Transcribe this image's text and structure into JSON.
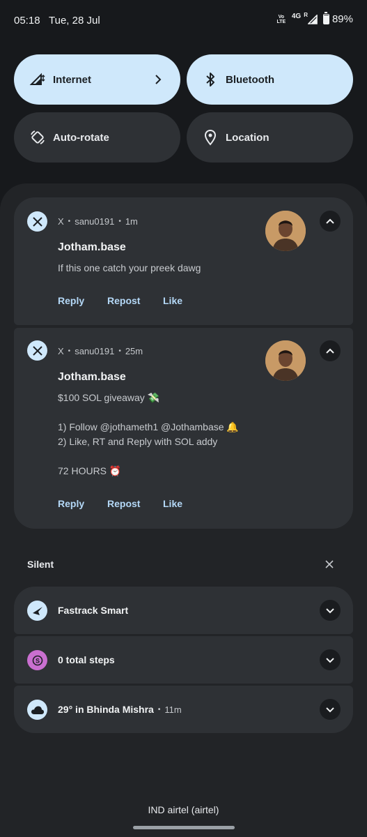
{
  "status_bar": {
    "time": "05:18",
    "date": "Tue, 28 Jul",
    "volte": "Vo LTE",
    "network": "4G",
    "roaming": "R",
    "battery": "89%",
    "battery_level": 0.89
  },
  "quick_tiles": [
    {
      "label": "Internet",
      "state": "on",
      "icon": "signal-icon"
    },
    {
      "label": "Bluetooth",
      "state": "on",
      "icon": "bluetooth-icon"
    },
    {
      "label": "Auto-rotate",
      "state": "off",
      "icon": "rotate-icon"
    },
    {
      "label": "Location",
      "state": "off",
      "icon": "location-pin-icon"
    }
  ],
  "notifications": [
    {
      "app": "X",
      "account": "sanu0191",
      "time": "1m",
      "title": "Jotham.base",
      "lines": [
        "If this one catch your preek dawg"
      ],
      "actions": [
        "Reply",
        "Repost",
        "Like"
      ]
    },
    {
      "app": "X",
      "account": "sanu0191",
      "time": "25m",
      "title": "Jotham.base",
      "lines": [
        "$100 SOL giveaway 💸",
        "1) Follow @jothameth1 @Jothambase 🔔",
        "2) Like, RT and Reply with SOL addy",
        "72 HOURS ⏰"
      ],
      "actions": [
        "Reply",
        "Repost",
        "Like"
      ]
    }
  ],
  "silent": {
    "header": "Silent",
    "items": [
      {
        "title": "Fastrack Smart",
        "time": "",
        "icon": "fastrack-icon",
        "icon_bg": "#cfe8fb"
      },
      {
        "title": "0 total steps",
        "time": "",
        "icon": "steps-icon",
        "icon_bg": "#c96fd0"
      },
      {
        "title": "29° in Bhinda Mishra",
        "time": "11m",
        "icon": "cloud-icon",
        "icon_bg": "#cfe8fb"
      }
    ]
  },
  "carrier": "IND airtel (airtel)",
  "colors": {
    "accent": "#cfe8fb",
    "action_text": "#b4d8f7",
    "card_bg": "#2e3135"
  }
}
